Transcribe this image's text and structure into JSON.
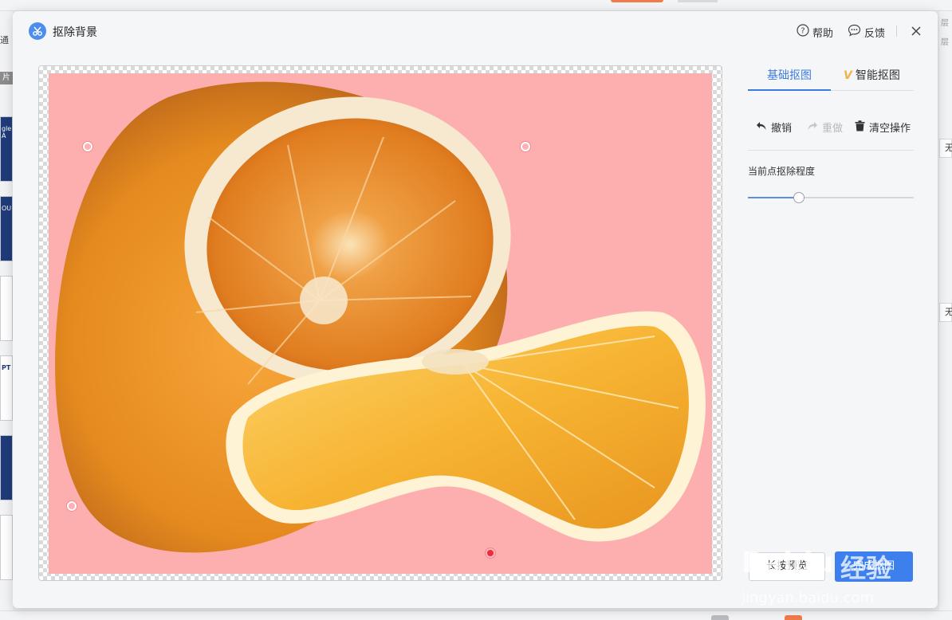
{
  "dialog": {
    "title": "抠除背景",
    "help_label": "帮助",
    "feedback_label": "反馈"
  },
  "tabs": [
    {
      "label": "基础抠图",
      "active": true
    },
    {
      "label": "智能抠图",
      "active": false,
      "badge": "V"
    }
  ],
  "actions": {
    "undo_label": "撤销",
    "redo_label": "重做",
    "clear_label": "清空操作"
  },
  "slider": {
    "label": "当前点抠除程度",
    "value_fraction": 0.31
  },
  "footer": {
    "preview_label": "长按预览",
    "done_label": "完成抠图"
  },
  "background_app": {
    "left_label_1": "通",
    "left_label_2": "片",
    "thumb_texts": [
      "gle A",
      "OU",
      "PT"
    ],
    "right_labels": [
      "层",
      "层"
    ],
    "right_box_text": "无"
  },
  "watermark": {
    "brand": "Baidu",
    "brand_cn": "经验",
    "url": "jingyan.baidu.com"
  },
  "colors": {
    "accent": "#3e7fee",
    "canvas_bg": "#fdafb0",
    "vip": "#f0b34a"
  }
}
